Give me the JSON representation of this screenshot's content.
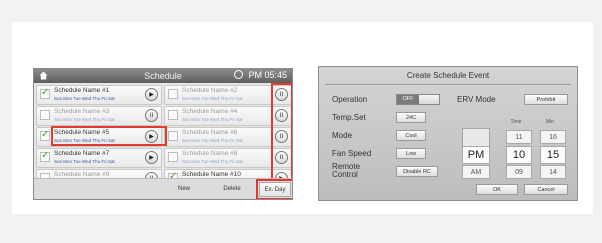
{
  "schedule_screen": {
    "title": "Schedule",
    "clock": "PM 05:45",
    "home_icon": "home-icon",
    "rows": [
      {
        "left": {
          "name": "Schedule Name #1",
          "days": "Sun Mon Tue Wed Thu Fri Sat",
          "checked": true,
          "control": "▶"
        },
        "right": {
          "name": "Schedule Name #2",
          "days": "Sun Mon Tue Wed Thu Fri Sat",
          "checked": false,
          "control": "II"
        }
      },
      {
        "left": {
          "name": "Schedule Name #3",
          "days": "Sun Mon Tue Wed Thu Fri Sat",
          "checked": false,
          "control": "II"
        },
        "right": {
          "name": "Schedule Name #4",
          "days": "Sun Mon Tue Wed Thu Fri Sat",
          "checked": false,
          "control": "II"
        }
      },
      {
        "left": {
          "name": "Schedule Name #5",
          "days": "Sun Mon Tue Wed Thu Fri Sat",
          "checked": true,
          "control": "▶"
        },
        "right": {
          "name": "Schedule Name #6",
          "days": "Sun Mon Tue Wed Thu Fri Sat",
          "checked": false,
          "control": "II"
        }
      },
      {
        "left": {
          "name": "Schedule Name #7",
          "days": "Sun Mon Tue Wed Thu Fri Sat",
          "checked": true,
          "control": "▶"
        },
        "right": {
          "name": "Schedule Name #8",
          "days": "Sun Mon Tue Wed Thu Fri Sat",
          "checked": false,
          "control": "II"
        }
      },
      {
        "left": {
          "name": "Schedule Name #9",
          "days": "Sun Mon Tue Wed Thu Fri Sat",
          "checked": false,
          "control": "II"
        },
        "right": {
          "name": "Schedule Name #10",
          "days": "Sun Mon Tue Wed Thu Fri Sat",
          "checked": true,
          "control": "▶"
        }
      }
    ],
    "footer": {
      "new": "New",
      "delete": "Delete",
      "ex_day": "Ex. Day"
    },
    "highlight_color": "#e23a2f"
  },
  "create_event_dialog": {
    "title": "Create Schedule Event",
    "operation_label": "Operation",
    "operation_value": "OFF",
    "temp_label": "Temp.Set",
    "temp_value": "24C",
    "mode_label": "Mode",
    "mode_value": "Cool",
    "fan_label": "Fan Speed",
    "fan_value": "Low",
    "remote_label": "Remote Control",
    "remote_value": "Disable RC",
    "erv_label": "ERV Mode",
    "erv_value": "Prohibit",
    "picker": {
      "hour_header": "Time",
      "min_header": "Min",
      "ampm": {
        "above": "",
        "selected": "PM",
        "below": "AM"
      },
      "hour": {
        "above": "11",
        "selected": "10",
        "below": "09"
      },
      "minute": {
        "above": "16",
        "selected": "15",
        "below": "14"
      }
    },
    "ok": "OK",
    "cancel": "Cancel"
  }
}
